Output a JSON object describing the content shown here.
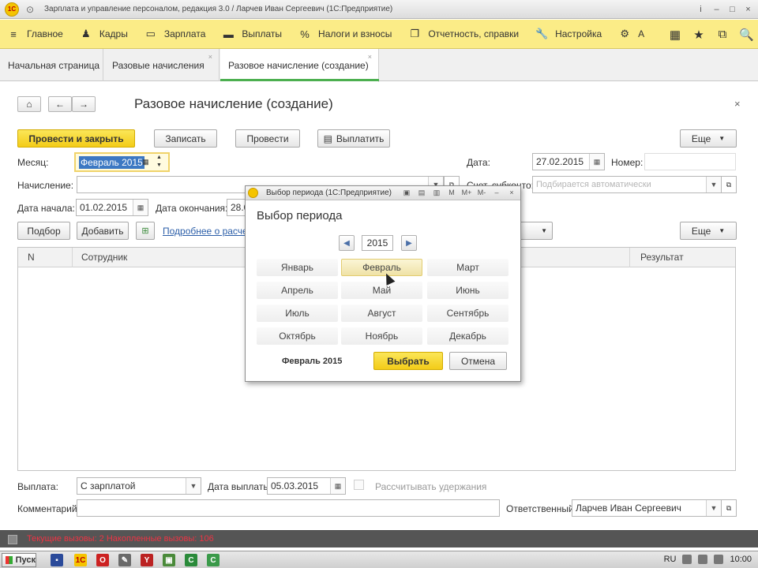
{
  "window": {
    "title": "Зарплата и управление персоналом, редакция 3.0 / Ларчев Иван Сергеевич (1С:Предприятие)",
    "controls": [
      "i",
      "–",
      "□",
      "×"
    ]
  },
  "main_menu": {
    "items": [
      {
        "icon": "≡",
        "label": "Главное"
      },
      {
        "icon": "♟",
        "label": "Кадры"
      },
      {
        "icon": "▭",
        "label": "Зарплата"
      },
      {
        "icon": "▬",
        "label": "Выплаты"
      },
      {
        "icon": "%",
        "label": "Налоги и взносы"
      },
      {
        "icon": "❐",
        "label": "Отчетность, справки"
      },
      {
        "icon": "🔧",
        "label": "Настройка"
      },
      {
        "icon": "⚙",
        "label": "А"
      }
    ],
    "right_icons": [
      "▦",
      "★",
      "⧉",
      "🔍"
    ]
  },
  "tabs": [
    {
      "label": "Начальная страница"
    },
    {
      "label": "Разовые начисления"
    },
    {
      "label": "Разовое начисление (создание)"
    }
  ],
  "form": {
    "title": "Разовое начисление (создание)",
    "buttons": {
      "post_close": "Провести и закрыть",
      "save": "Записать",
      "post": "Провести",
      "pay": "Выплатить",
      "more": "Еще"
    },
    "fields": {
      "month_label": "Месяц:",
      "month_value": "Февраль 2015",
      "accrual_label": "Начисление:",
      "accrual_value": "",
      "start_label": "Дата начала:",
      "start_value": "01.02.2015",
      "end_label": "Дата окончания:",
      "end_value": "28.0",
      "date_label": "Дата:",
      "date_value": "27.02.2015",
      "number_label": "Номер:",
      "number_value": "",
      "account_label": "Счет, субконто:",
      "account_placeholder": "Подбирается автоматически"
    },
    "table_toolbar": {
      "pick": "Подбор",
      "add": "Добавить",
      "details_link": "Подробнее о расчете",
      "more": "Еще"
    },
    "table": {
      "columns": [
        "N",
        "Сотрудник",
        "Результат"
      ],
      "rows": []
    },
    "footer": {
      "payment_label": "Выплата:",
      "payment_value": "С зарплатой",
      "payment_date_label": "Дата выплаты:",
      "payment_date_value": "05.03.2015",
      "withhold_label": "Рассчитывать удержания",
      "comment_label": "Комментарий:",
      "comment_value": "",
      "responsible_label": "Ответственный:",
      "responsible_value": "Ларчев Иван Сергеевич"
    }
  },
  "status_bar": {
    "text": "Текущие вызовы: 2  Накопленные вызовы: 106"
  },
  "taskbar": {
    "start": "Пуск",
    "lang": "RU",
    "time": "10:00"
  },
  "dialog": {
    "title": "Выбор периода (1С:Предприятие)",
    "heading": "Выбор периода",
    "year": "2015",
    "months": [
      "Январь",
      "Февраль",
      "Март",
      "Апрель",
      "Май",
      "Июнь",
      "Июль",
      "Август",
      "Сентябрь",
      "Октябрь",
      "Ноябрь",
      "Декабрь"
    ],
    "selected_month_index": 1,
    "selected_text": "Февраль 2015",
    "select_button": "Выбрать",
    "cancel_button": "Отмена",
    "controls": [
      "▣",
      "▤",
      "▥",
      "M",
      "M+",
      "M-",
      "–",
      "×"
    ]
  },
  "colors": {
    "menu_bg": "#fbec87",
    "primary_button": "#f3cc18",
    "tab_accent": "#4caf50",
    "link": "#2b5ea8"
  }
}
